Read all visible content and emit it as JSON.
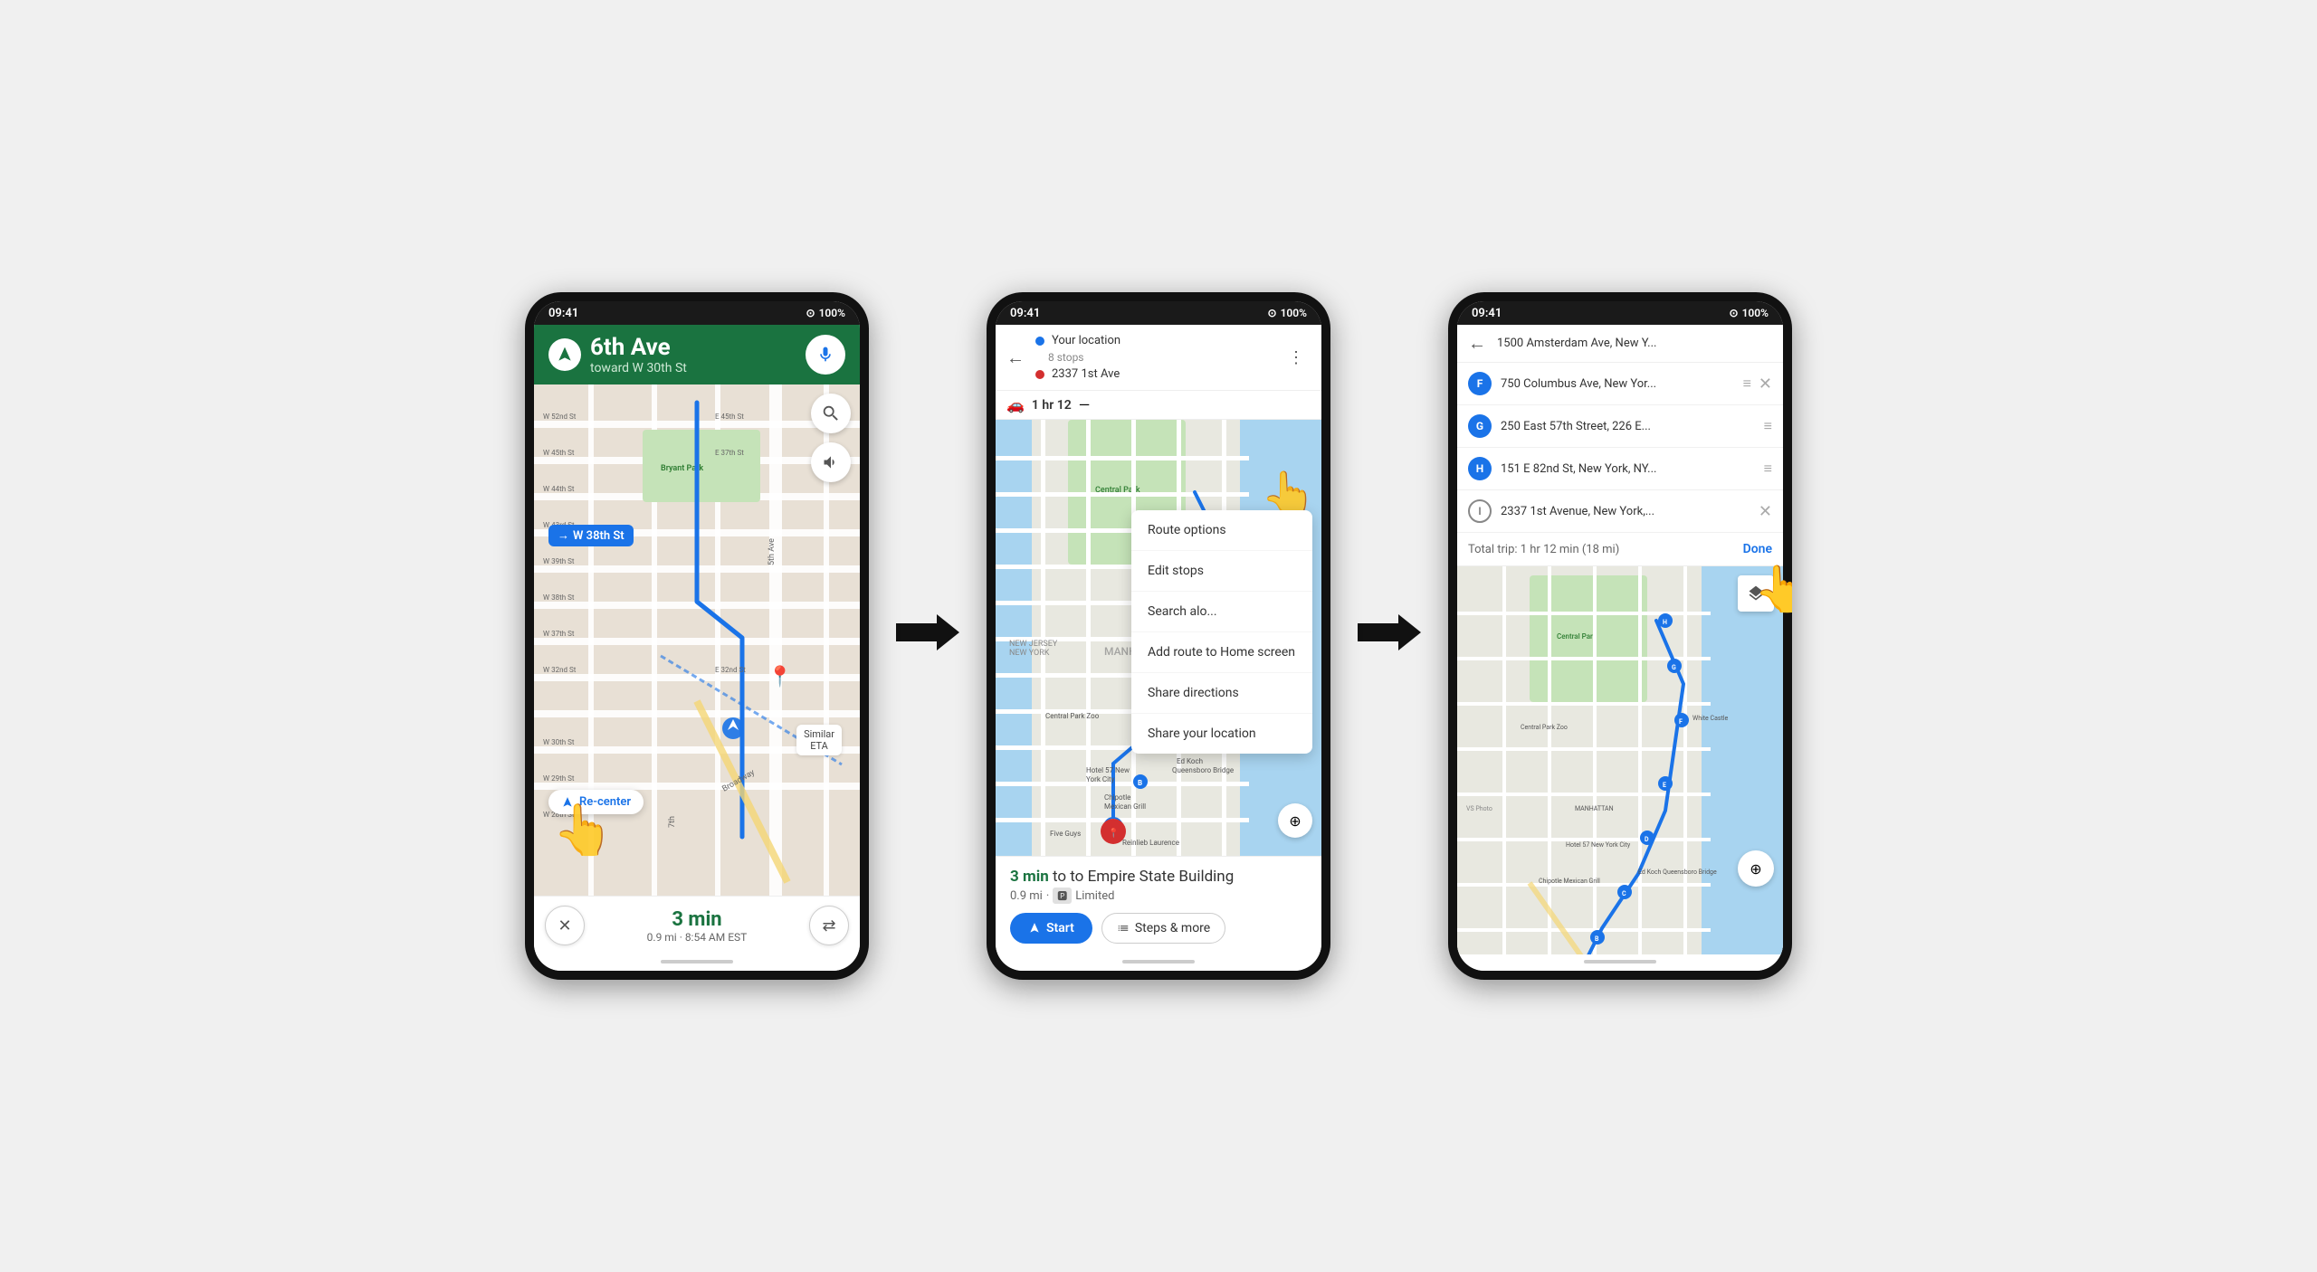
{
  "phone1": {
    "statusBar": {
      "time": "09:41",
      "battery": "100%",
      "signal": "●"
    },
    "navHeader": {
      "direction": "↑",
      "street": "6th Ave",
      "toward": "toward W 30th St",
      "mic": "🎤"
    },
    "map": {
      "streetBadge": "→ W 38th St",
      "bryantPark": "Bryant Park",
      "similarEta": "Similar\nETA"
    },
    "bottomBar": {
      "cancel": "✕",
      "etaTime": "3 min",
      "etaDetails": "0.9 mi · 8:54 AM EST",
      "routes": "⇄"
    },
    "recenter": "Re-center",
    "homeBar": "—"
  },
  "phone2": {
    "statusBar": {
      "time": "09:41",
      "battery": "100%"
    },
    "header": {
      "back": "←",
      "yourLocation": "Your location",
      "stops": "8 stops",
      "destination": "2337 1st Ave",
      "moreOptions": "⋮"
    },
    "subBar": {
      "transport": "🚗",
      "duration": "1 hr 12",
      "separator": "—"
    },
    "dropdownMenu": {
      "items": [
        "Route options",
        "Edit stops",
        "Search alo...",
        "Add route to Home screen",
        "Share directions",
        "Share your location"
      ]
    },
    "bottomInfo": {
      "timeText": "3 min",
      "destination": "to Empire State Building",
      "distance": "0.9 mi",
      "parking": "Limited"
    },
    "actions": {
      "startLabel": "Start",
      "stepsLabel": "Steps & more"
    },
    "homeBar": "—"
  },
  "phone3": {
    "statusBar": {
      "time": "09:41",
      "battery": "100%"
    },
    "header": {
      "back": "←",
      "topStop": "1500 Amsterdam Ave, New Y..."
    },
    "stops": [
      {
        "letter": "F",
        "name": "750 Columbus Ave, New Yor...",
        "hasDrag": true,
        "hasClose": true
      },
      {
        "letter": "G",
        "name": "250 East 57th Street, 226 E...",
        "hasDrag": true,
        "hasClose": false
      },
      {
        "letter": "H",
        "name": "151 E 82nd St, New York, NY...",
        "hasDrag": true,
        "hasClose": false
      },
      {
        "letter": "I",
        "name": "2337 1st Avenue, New York,...",
        "hasDrag": false,
        "hasClose": true
      }
    ],
    "totalTrip": {
      "label": "Total trip: 1 hr 12 min (18 mi)",
      "done": "Done"
    },
    "homeBar": "—"
  },
  "arrows": {
    "arrow1": "➔",
    "arrow2": "➔"
  },
  "hand_cursor": "👆",
  "colors": {
    "green": "#1a7340",
    "blue": "#1a73e8",
    "red": "#d32f2f",
    "darkBg": "#1a1a1a",
    "mapBg": "#e8e0d5"
  }
}
